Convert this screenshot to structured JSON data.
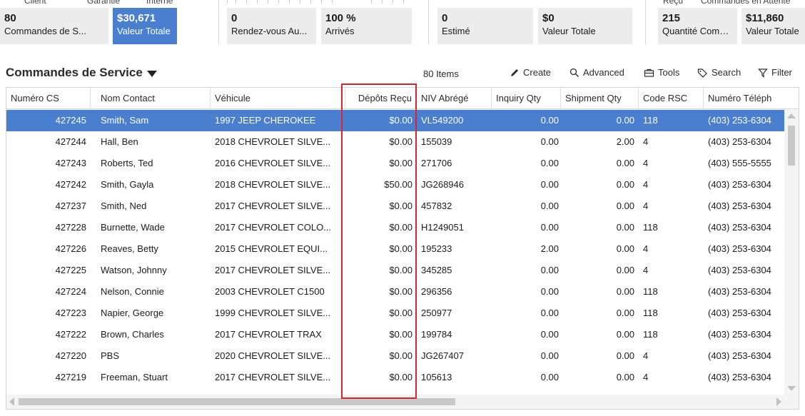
{
  "kpi_headers": [
    "Client",
    "Garantie",
    "Interne",
    "Reçu",
    "Commandes en Attente"
  ],
  "kpi_tiles": [
    {
      "value": "80",
      "label": "Commandes de S...",
      "active": false
    },
    {
      "value": "$30,671",
      "label": "Valeur Totale",
      "active": true
    },
    {
      "value": "0",
      "label": "Rendez-vous Au...",
      "active": false
    },
    {
      "value": "100 %",
      "label": "Arrivés",
      "active": false
    },
    {
      "value": "0",
      "label": "Estimé",
      "active": false
    },
    {
      "value": "$0",
      "label": "Valeur Totale",
      "active": false
    },
    {
      "value": "215",
      "label": "Quantité Comm...",
      "active": false
    },
    {
      "value": "$11,860",
      "label": "Valeur Totale",
      "active": false
    }
  ],
  "toolbar": {
    "title": "Commandes de Service",
    "item_count": "80 Items",
    "create_label": "Create",
    "advanced_label": "Advanced",
    "tools_label": "Tools",
    "search_label": "Search",
    "filter_label": "Filter"
  },
  "colors": {
    "accent": "#4a7fcf",
    "highlight": "#d9232d"
  },
  "grid": {
    "columns": [
      "Numéro CS",
      "Nom Contact",
      "Véhicule",
      "Dépôts Reçu",
      "NIV Abrégé",
      "Inquiry Qty",
      "Shipment Qty",
      "Code RSC",
      "Numéro Téléph"
    ],
    "selected_row": 0,
    "rows": [
      [
        "427245",
        "Smith, Sam",
        "1997 JEEP CHEROKEE",
        "$0.00",
        "VL549200",
        "0.00",
        "0.00",
        "118",
        "(403) 253-6304"
      ],
      [
        "427244",
        "Hall, Ben",
        "2018 CHEVROLET SILVE...",
        "$0.00",
        "155039",
        "0.00",
        "2.00",
        "4",
        "(403) 253-6304"
      ],
      [
        "427243",
        "Roberts, Ted",
        "2016 CHEVROLET SILVE...",
        "$0.00",
        "271706",
        "0.00",
        "0.00",
        "4",
        "(403) 555-5555"
      ],
      [
        "427242",
        "Smith, Gayla",
        "2018 CHEVROLET SILVE...",
        "$50.00",
        "JG268946",
        "0.00",
        "0.00",
        "4",
        "(403) 253-6304"
      ],
      [
        "427237",
        "Smith, Ned",
        "2017 CHEVROLET SILVE...",
        "$0.00",
        "457832",
        "0.00",
        "0.00",
        "4",
        "(403) 253-6304"
      ],
      [
        "427228",
        "Burnette, Wade",
        "2017 CHEVROLET COLO...",
        "$0.00",
        "H1249051",
        "0.00",
        "0.00",
        "118",
        "(403) 253-6304"
      ],
      [
        "427226",
        "Reaves, Betty",
        "2015 CHEVROLET EQUI...",
        "$0.00",
        "195233",
        "2.00",
        "0.00",
        "4",
        "(403) 253-6304"
      ],
      [
        "427225",
        "Watson, Johnny",
        "2017 CHEVROLET SILVE...",
        "$0.00",
        "345285",
        "0.00",
        "0.00",
        "4",
        "(403) 253-6304"
      ],
      [
        "427224",
        "Nelson, Connie",
        "2003 CHEVROLET C1500",
        "$0.00",
        "296356",
        "0.00",
        "0.00",
        "118",
        "(403) 253-6304"
      ],
      [
        "427223",
        "Napier, George",
        "1999 CHEVROLET SILVE...",
        "$0.00",
        "250977",
        "0.00",
        "0.00",
        "118",
        "(403) 253-6304"
      ],
      [
        "427222",
        "Brown, Charles",
        "2017 CHEVROLET TRAX",
        "$0.00",
        "199784",
        "0.00",
        "0.00",
        "118",
        "(403) 253-6304"
      ],
      [
        "427220",
        "PBS",
        "2020 CHEVROLET SILVE...",
        "$0.00",
        "JG267407",
        "0.00",
        "0.00",
        "4",
        "(403) 253-6304"
      ],
      [
        "427219",
        "Freeman, Stuart",
        "2017 CHEVROLET SILVE...",
        "$0.00",
        "105613",
        "0.00",
        "0.00",
        "4",
        "(403) 253-6304"
      ]
    ]
  }
}
